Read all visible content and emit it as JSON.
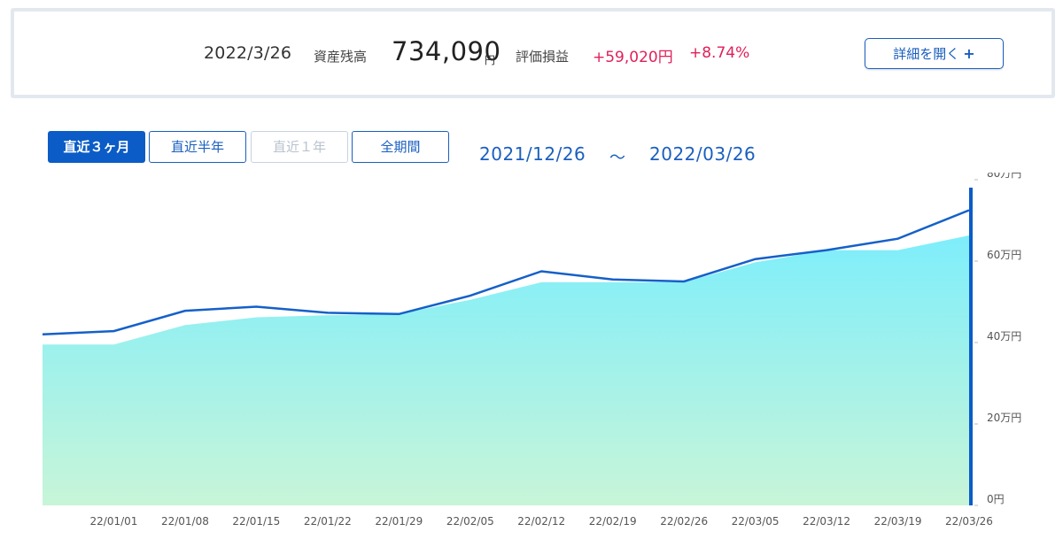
{
  "summary": {
    "date": "2022/3/26",
    "balance_label": "資産残高",
    "balance_value": "734,090",
    "balance_unit": "円",
    "pl_label": "評価損益",
    "pl_amount": "+59,020円",
    "pl_percent": "+8.74%",
    "detail_button_label": "詳細を開く",
    "detail_button_icon": "plus-icon"
  },
  "range_buttons": [
    {
      "label": "直近３ヶ月",
      "state": "active"
    },
    {
      "label": "直近半年",
      "state": "normal"
    },
    {
      "label": "直近１年",
      "state": "disabled"
    },
    {
      "label": "全期間",
      "state": "normal"
    }
  ],
  "period": {
    "start": "2021/12/26",
    "separator": "～",
    "end": "2022/03/26"
  },
  "colors": {
    "accent": "#0b5cc7",
    "line": "#1560c9",
    "positive": "#e0205a",
    "area_top": "#7eeefb",
    "area_bottom": "#c8f5d8"
  },
  "chart_data": {
    "type": "area",
    "x": [
      "21/12/26",
      "22/01/01",
      "22/01/08",
      "22/01/15",
      "22/01/22",
      "22/01/29",
      "22/02/05",
      "22/02/12",
      "22/02/19",
      "22/02/26",
      "22/03/05",
      "22/03/12",
      "22/03/19",
      "22/03/26"
    ],
    "x_tick_labels": [
      "22/01/01",
      "22/01/08",
      "22/01/15",
      "22/01/22",
      "22/01/29",
      "22/02/05",
      "22/02/12",
      "22/02/19",
      "22/02/26",
      "22/03/05",
      "22/03/12",
      "22/03/19",
      "22/03/26"
    ],
    "y_tick_labels": [
      "0円",
      "20万円",
      "40万円",
      "60万円",
      "80万円"
    ],
    "y_ticks": [
      0,
      200000,
      400000,
      600000,
      800000
    ],
    "ylim": [
      0,
      800000
    ],
    "y_axis_side": "right",
    "series": [
      {
        "style": "line",
        "values": [
          420000,
          428000,
          478000,
          488000,
          473000,
          470000,
          515000,
          575000,
          555000,
          550000,
          605000,
          627000,
          655000,
          725000
        ]
      },
      {
        "style": "area",
        "values": [
          395000,
          395000,
          443000,
          462000,
          467000,
          470000,
          505000,
          548000,
          548000,
          548000,
          597000,
          627000,
          627000,
          663000
        ]
      }
    ],
    "marker_at": "22/03/26"
  }
}
